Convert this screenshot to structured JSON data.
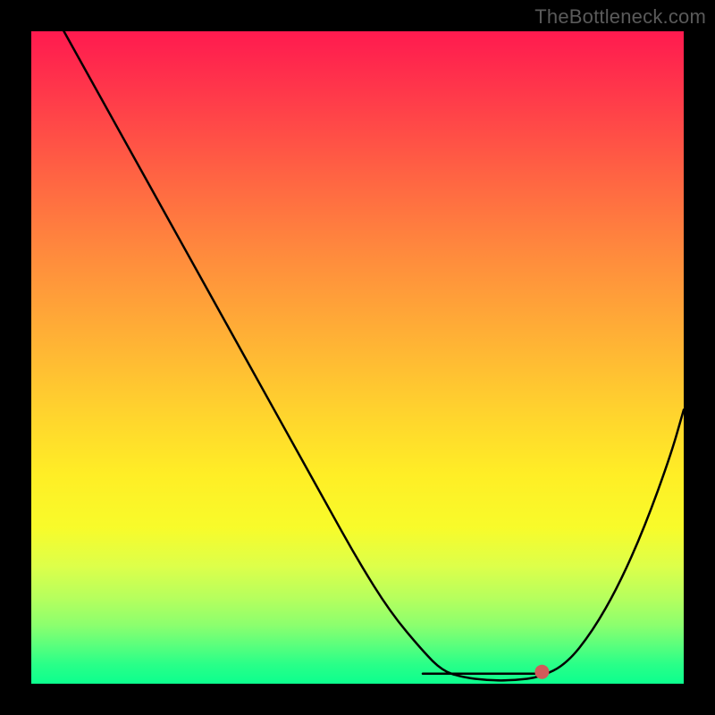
{
  "watermark": "TheBottleneck.com",
  "chart_data": {
    "type": "line",
    "title": "",
    "xlabel": "",
    "ylabel": "",
    "xlim": [
      0,
      100
    ],
    "ylim": [
      0,
      100
    ],
    "grid": false,
    "legend": false,
    "series": [
      {
        "name": "bottleneck-curve",
        "x": [
          5,
          10,
          15,
          20,
          25,
          30,
          35,
          40,
          45,
          50,
          55,
          60,
          63,
          66,
          70,
          74,
          78,
          82,
          86,
          90,
          94,
          98,
          100
        ],
        "y": [
          100,
          91,
          82,
          73,
          64,
          55,
          46,
          37,
          28,
          19,
          11,
          5,
          2,
          1,
          0.5,
          0.5,
          1,
          3,
          8,
          15,
          24,
          35,
          42
        ]
      }
    ],
    "highlighted_range": {
      "name": "optimal-range",
      "x_start": 60,
      "x_end": 78,
      "y": 1
    },
    "background_gradient": {
      "top": "#ff1a4f",
      "mid": "#ffee26",
      "bottom": "#0cff8e"
    }
  },
  "colors": {
    "frame": "#000000",
    "curve": "#000000",
    "highlight": "#d15a5a",
    "watermark": "#5a5a5a"
  }
}
